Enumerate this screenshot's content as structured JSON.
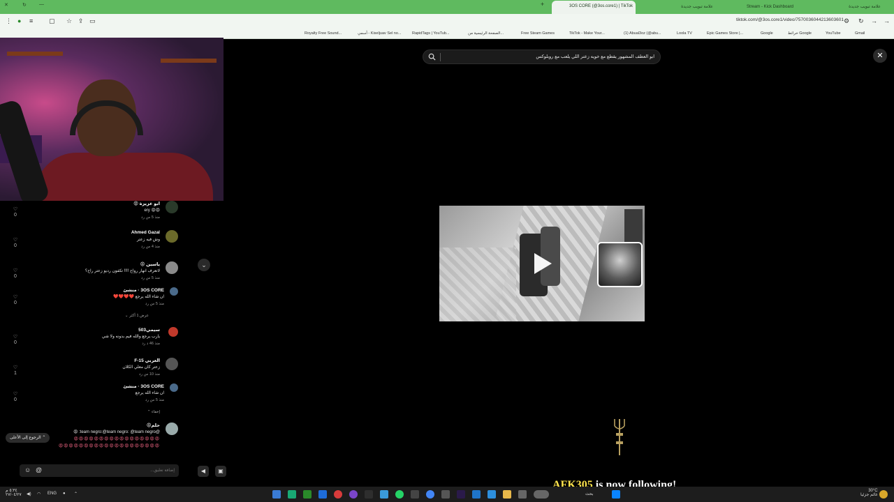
{
  "browser": {
    "tabs": [
      {
        "title": "علامة تبويب جديدة",
        "active": false
      },
      {
        "title": "Stream - Kick Dashboard",
        "active": false
      },
      {
        "title": "علامة تبويب جديدة",
        "active": false
      },
      {
        "title": "3OS CORE (@3os.core1) | TikTok",
        "active": true
      }
    ],
    "new_tab_label": "+",
    "url": "tiktok.com/@3os.core1/video/7570036044213603601",
    "bookmarks": [
      "Gmail",
      "YouTube",
      "خرائط Google",
      "Google",
      "Epic Games Store |...",
      "Loola TV",
      "(1) Abual3oz (@abu...",
      "TikTok - Make Your...",
      "Free Steam Games",
      "الصفحة الرئيسية من...",
      "RapidTags | YouTub...",
      "أسمي - Kiseljuav Sel no...",
      "Royalty Free Sound..."
    ]
  },
  "comments": {
    "items": [
      {
        "name": "ابو عزيزة 😡",
        "text": "😡😡 ery",
        "meta": "منذ 5 س  رد",
        "likes": "0"
      },
      {
        "name": "Ahmed Gazal",
        "text": "وش فيه زعتر",
        "meta": "منذ 4 س  رد",
        "likes": "0"
      },
      {
        "name": "ياسين 😡",
        "text": "لاتعرف انهار رواح !!!! تكفون رديو زعتر راح؟",
        "meta": "منذ 5 س  رد",
        "likes": "0"
      },
      {
        "name": "3OS CORE · منشئ",
        "text": "ان شاء الله يرجع ❤️❤️❤️❤️",
        "meta": "منذ 5 س  رد",
        "likes": "0"
      },
      {
        "name": "سيمي503",
        "text": "يارب يرجع والله فيم بدونه ولا شي",
        "meta": "منذ 46 د  رد",
        "likes": "0"
      },
      {
        "name": "العربي F-15",
        "text": "زعتر كان معلي الكلان",
        "meta": "منذ 10 س  رد",
        "likes": "1"
      },
      {
        "name": "3OS CORE · منشئ",
        "text": "ان شاء الله يرجع",
        "meta": "منذ 5 س  رد",
        "likes": "0"
      },
      {
        "name": "حلم😡",
        "text": "@team negro:@team negro: @team negro: 😡",
        "meta": "",
        "likes": ""
      }
    ],
    "view_more": "عرض 1 أكثر",
    "hide": "إخفاء",
    "back_to_top": "الرجوع إلى الأعلى",
    "input_placeholder": "إضافة تعليق...",
    "mention_symbol": "@",
    "emoji_symbol": "☺"
  },
  "player": {
    "search_query": "ابو العطف المشهور يقطع مع خويه زعتر اللي يلعب مع روبلوكس",
    "close_symbol": "✕"
  },
  "alert": {
    "follower": "AFK305",
    "message": " is now following!"
  },
  "taskbar": {
    "language": "ENG",
    "time": "٥:٣٤ م",
    "date": "٢٧/٠٤/٢٧",
    "weather": "30°C",
    "weather_desc": "غائم جزئيا",
    "search_label": "بحث"
  },
  "colors": {
    "accent": "#fe2c55",
    "browser_green": "#5fba5f",
    "alert_name": "#ffe44d"
  }
}
